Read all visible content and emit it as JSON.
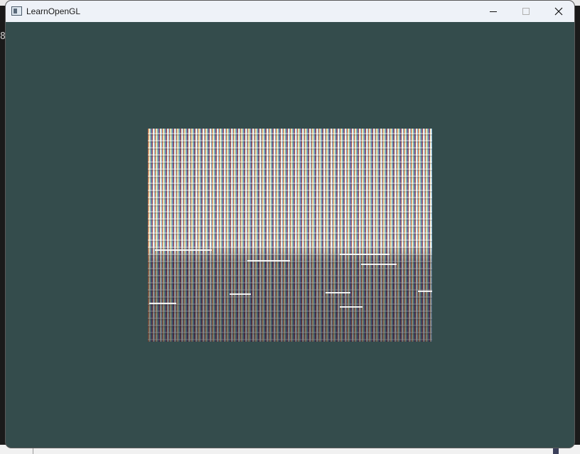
{
  "window": {
    "title": "LearnOpenGL",
    "minimize_icon": "minimize-icon",
    "maximize_icon": "maximize-icon",
    "close_icon": "close-icon",
    "app_icon": "window-app-icon"
  },
  "background": {
    "side_text": "8"
  },
  "colors": {
    "clear_color": "#344c4c",
    "titlebar": "#eef2f8"
  }
}
